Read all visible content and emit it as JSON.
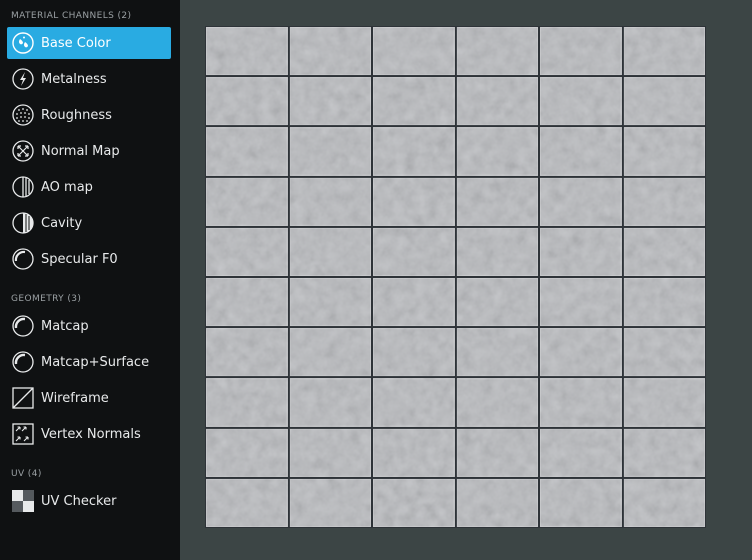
{
  "sections": {
    "material": {
      "label": "MATERIAL CHANNELS (2)"
    },
    "geometry": {
      "label": "GEOMETRY (3)"
    },
    "uv": {
      "label": "UV (4)"
    }
  },
  "items": {
    "base_color": {
      "label": "Base Color",
      "icon": "base-color-icon",
      "active": true
    },
    "metalness": {
      "label": "Metalness",
      "icon": "lightning-icon"
    },
    "roughness": {
      "label": "Roughness",
      "icon": "dotted-sphere-icon"
    },
    "normal_map": {
      "label": "Normal Map",
      "icon": "arrows-sphere-icon"
    },
    "ao_map": {
      "label": "AO map",
      "icon": "striped-sphere-icon"
    },
    "cavity": {
      "label": "Cavity",
      "icon": "cavity-sphere-icon"
    },
    "specular_f0": {
      "label": "Specular F0",
      "icon": "specular-sphere-icon"
    },
    "matcap": {
      "label": "Matcap",
      "icon": "matcap-sphere-icon"
    },
    "matcap_surface": {
      "label": "Matcap+Surface",
      "icon": "matcap-surface-icon"
    },
    "wireframe": {
      "label": "Wireframe",
      "icon": "wireframe-icon"
    },
    "vertex_normals": {
      "label": "Vertex Normals",
      "icon": "vertex-normals-icon"
    },
    "uv_checker": {
      "label": "UV Checker",
      "icon": "checker-icon"
    }
  },
  "viewport": {
    "grid": {
      "columns": 6,
      "rows": 10
    },
    "colors": {
      "tile": "#b8babe",
      "grout": "#2e3338",
      "accent": "#29abe2",
      "sidebar": "#0f1112",
      "background": "#3c4545"
    }
  }
}
